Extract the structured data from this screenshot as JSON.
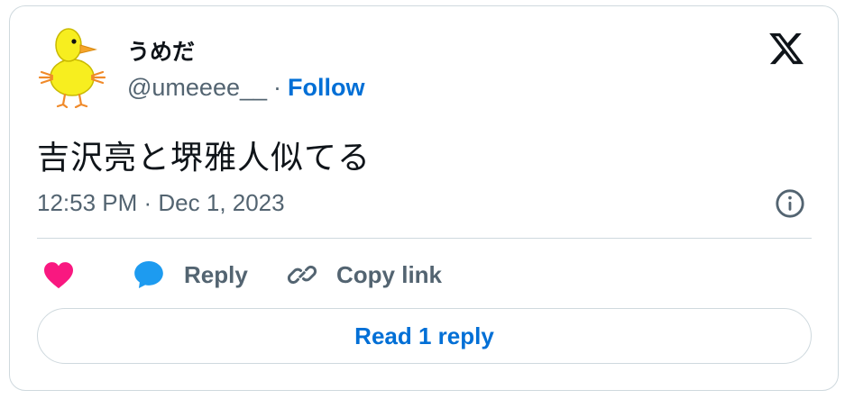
{
  "author": {
    "display_name": "うめだ",
    "handle": "@umeeee__",
    "separator": "·",
    "follow_label": "Follow",
    "avatar_icon": "yellow-chick-icon"
  },
  "brand": {
    "logo_icon": "x-logo-icon"
  },
  "tweet": {
    "text": "吉沢亮と堺雅人似てる",
    "timestamp": "12:53 PM · Dec 1, 2023"
  },
  "actions": {
    "like_icon": "heart-icon",
    "reply_icon": "speech-bubble-icon",
    "reply_label": "Reply",
    "copy_icon": "link-icon",
    "copy_label": "Copy link",
    "info_icon": "info-icon"
  },
  "read_replies": {
    "label": "Read 1 reply"
  },
  "colors": {
    "link_blue": "#006fd6",
    "heart_pink": "#f91880",
    "reply_blue": "#1d9bf0",
    "text_primary": "#0f1419",
    "text_secondary": "#536471",
    "border": "#cfd9de"
  }
}
